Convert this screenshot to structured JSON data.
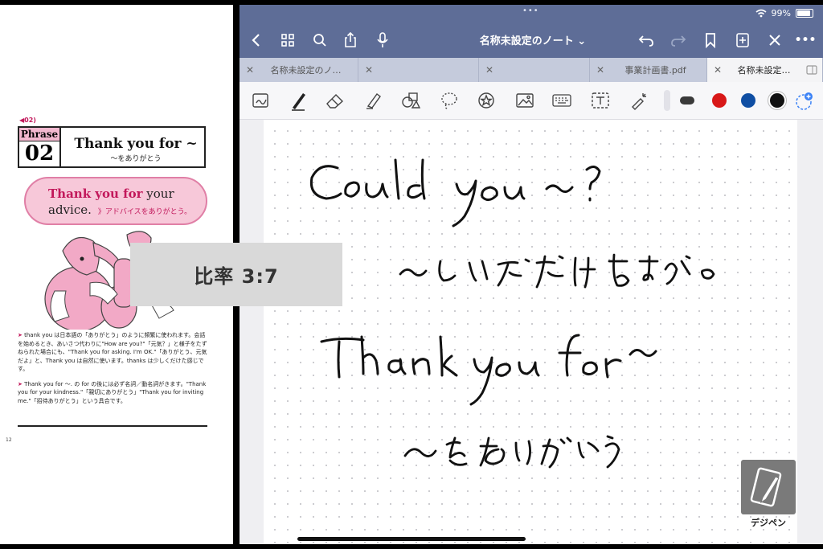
{
  "book": {
    "audio_label": "02",
    "phrase_word": "Phrase",
    "phrase_number": "02",
    "title": "Thank you for ~",
    "subtitle": "～をありがとう",
    "bubble_bold": "Thank you for",
    "bubble_rest": " your",
    "bubble_line2": "advice.",
    "bubble_jp": "》アドバイスをありがとう。",
    "note1": "thank you は日本語の「ありがとう」のように頻繁に使われます。会話を始めるとき、あいさつ代わりに\"How are you?\"「元気？」と様子をたずねられた場合にも、\"Thank you for asking. I'm OK.\"「ありがとう、元気だよ」と、Thank you は自然に使います。thanks は少しくだけた感じです。",
    "note2": "Thank you for ～. の for の後には必ず名詞／動名詞がきます。\"Thank you for your kindness.\"「親切にありがとう」\"Thank you for inviting me.\"「招待ありがとう」という具合です。",
    "page_number": "12"
  },
  "overlay": {
    "ratio_label": "比率 3:7"
  },
  "status": {
    "battery_text": "99%"
  },
  "nav": {
    "back_icon": "chevron-left-icon",
    "title": "名称未設定のノート ⌄",
    "menu": "•••"
  },
  "tabs": [
    {
      "label": "名称未設定のノ…",
      "active": false
    },
    {
      "label": "",
      "active": false
    },
    {
      "label": "",
      "active": false
    },
    {
      "label": "事業計画書.pdf",
      "active": false
    },
    {
      "label": "名称未設定…",
      "active": true
    }
  ],
  "toolbar": {
    "colors": [
      "#3a3a3a",
      "#d81818",
      "#0f4ea3",
      "#111111"
    ],
    "selected_color": "#111111"
  },
  "logo": {
    "text": "デジペン"
  }
}
